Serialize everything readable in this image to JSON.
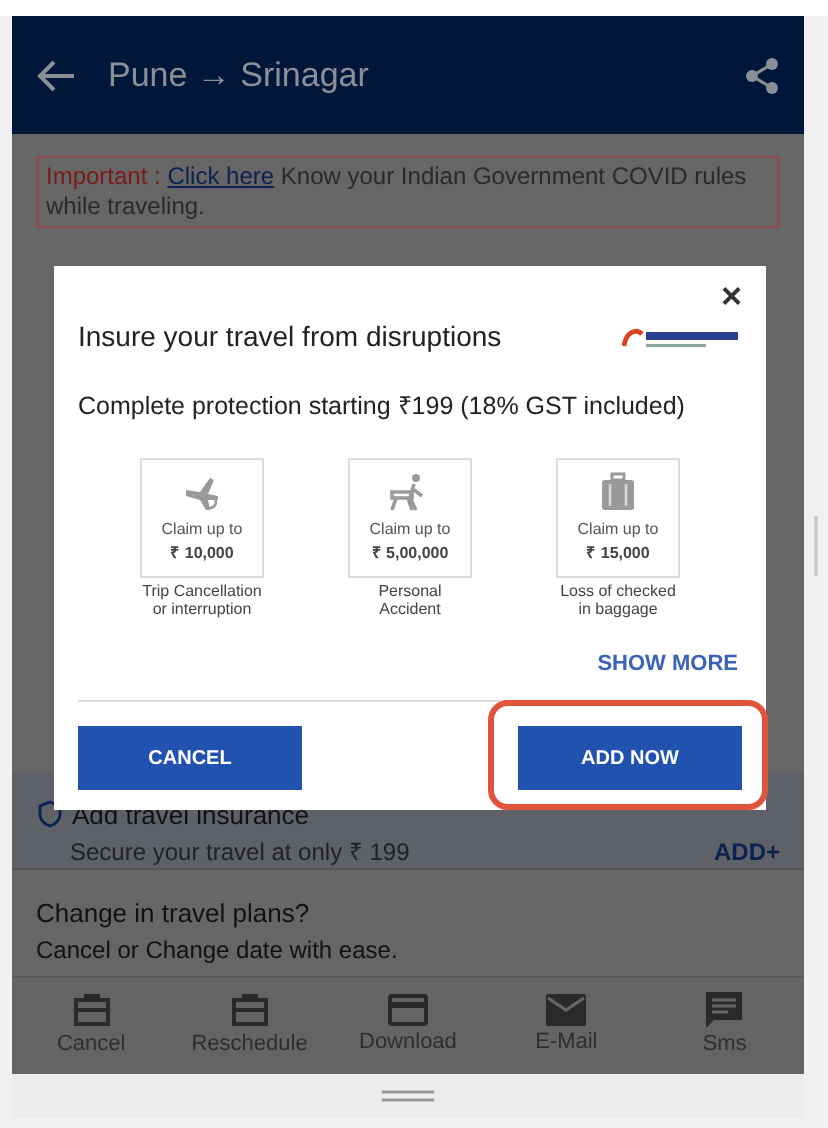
{
  "header": {
    "title": "Pune → Srinagar"
  },
  "notice": {
    "label": "Important :",
    "link": "Click here",
    "text": "Know your Indian Government COVID rules while traveling."
  },
  "insurance_row": {
    "title": "Add travel insurance",
    "subtitle": "Secure your travel at only ₹ 199",
    "action": "ADD+"
  },
  "change_plans": {
    "title": "Change in travel plans?",
    "subtitle": "Cancel or Change date with ease."
  },
  "bottom_nav": [
    {
      "kind": "briefcase",
      "label": "Cancel"
    },
    {
      "kind": "briefcase",
      "label": "Reschedule"
    },
    {
      "kind": "card",
      "label": "Download"
    },
    {
      "kind": "mail",
      "label": "E-Mail"
    },
    {
      "kind": "chat",
      "label": "Sms"
    }
  ],
  "modal": {
    "close": "×",
    "title": "Insure your travel from disruptions",
    "subtitle": "Complete protection starting ₹199 (18% GST included)",
    "benefits": [
      {
        "kind": "plane",
        "claim": "Claim up to",
        "amount": "₹ 10,000",
        "caption": "Trip Cancellation or interruption"
      },
      {
        "kind": "accident",
        "claim": "Claim up to",
        "amount": "₹ 5,00,000",
        "caption": "Personal Accident"
      },
      {
        "kind": "baggage",
        "claim": "Claim up to",
        "amount": "₹ 15,000",
        "caption": "Loss of checked in baggage"
      }
    ],
    "show_more": "SHOW MORE",
    "cancel": "CANCEL",
    "add_now": "ADD NOW",
    "add_now_highlighted": true
  }
}
